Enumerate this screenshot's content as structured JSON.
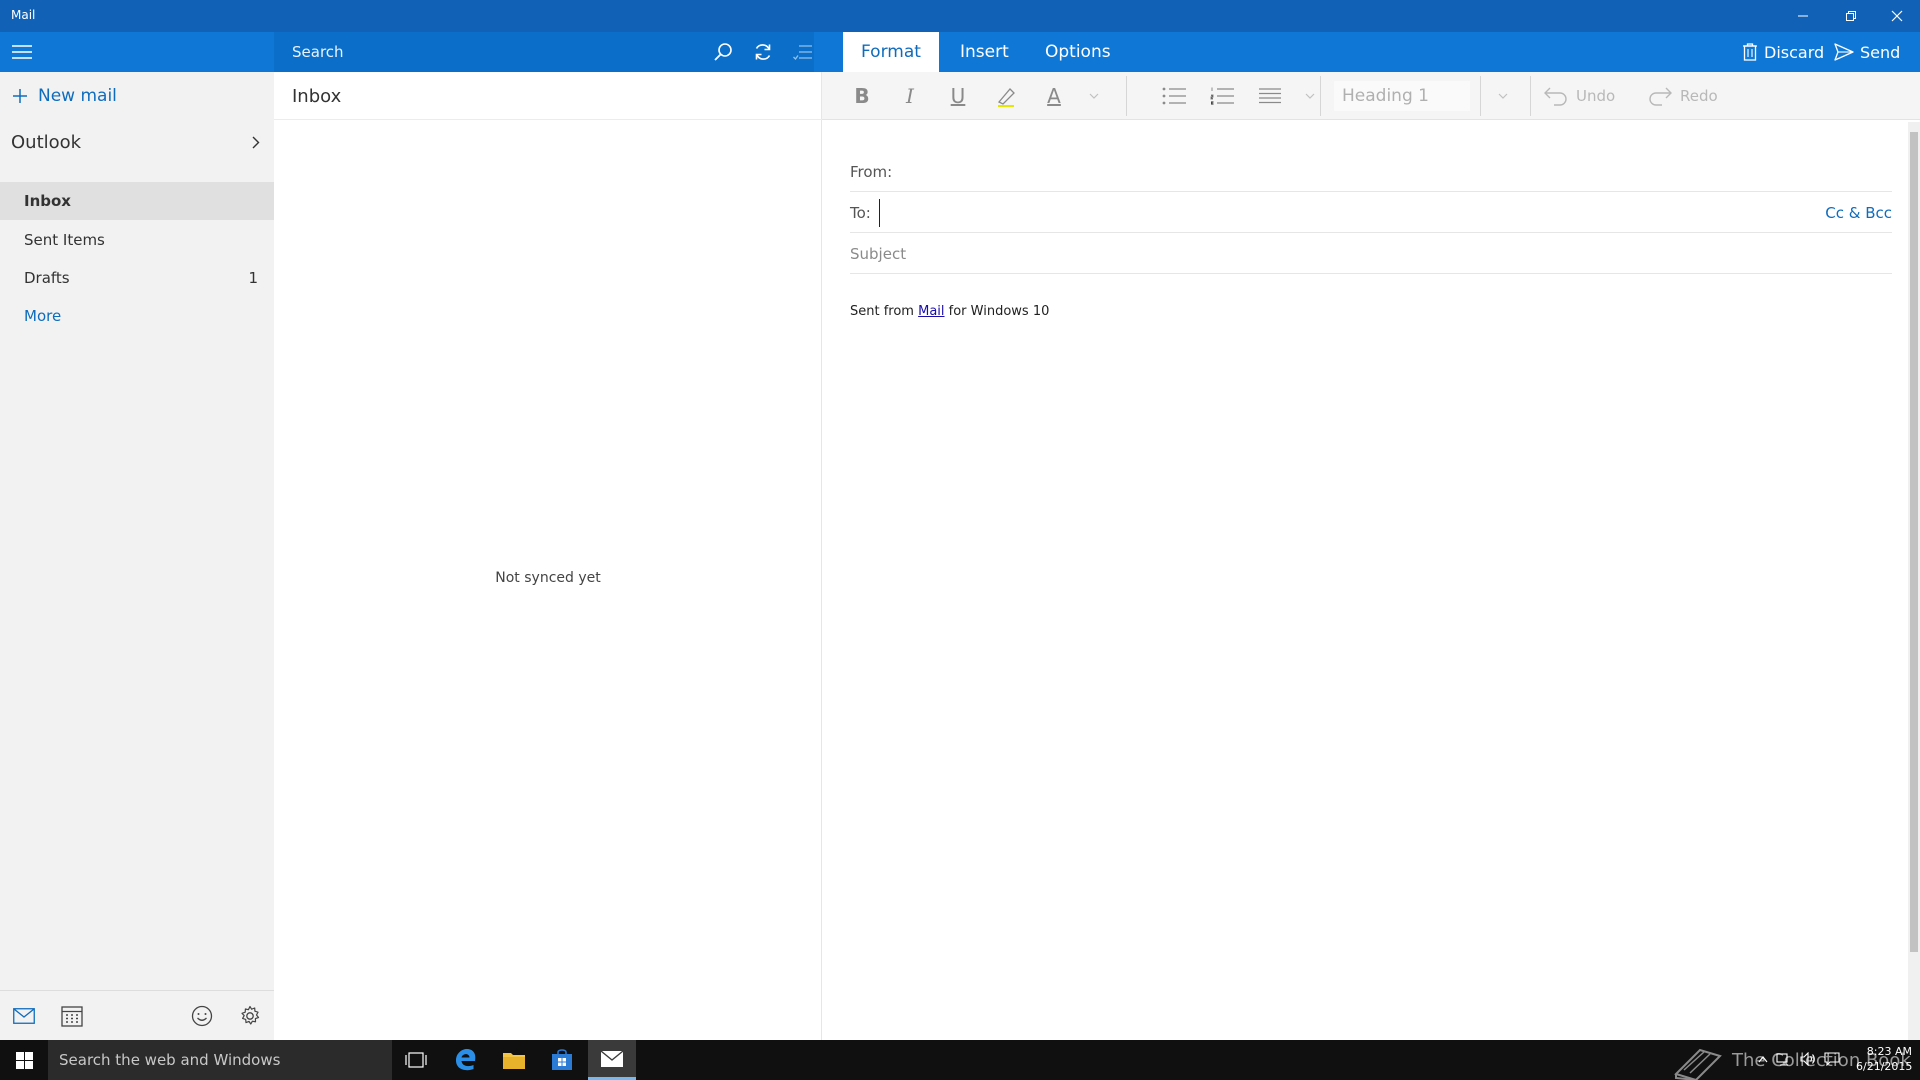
{
  "window": {
    "title": "Mail"
  },
  "commandbar": {
    "search_placeholder": "Search",
    "tabs": [
      {
        "label": "Format",
        "active": true
      },
      {
        "label": "Insert",
        "active": false
      },
      {
        "label": "Options",
        "active": false
      }
    ],
    "discard_label": "Discard",
    "send_label": "Send"
  },
  "nav": {
    "new_mail_label": "New mail",
    "account": "Outlook",
    "folders": [
      {
        "label": "Inbox",
        "count": "",
        "selected": true
      },
      {
        "label": "Sent Items",
        "count": "",
        "selected": false
      },
      {
        "label": "Drafts",
        "count": "1",
        "selected": false
      }
    ],
    "more_label": "More"
  },
  "message_list": {
    "title": "Inbox",
    "empty_text": "Not synced yet"
  },
  "compose": {
    "toolbar": {
      "bold": "B",
      "italic": "I",
      "underline": "U",
      "font_color": "A",
      "style": "Heading 1",
      "undo_label": "Undo",
      "redo_label": "Redo"
    },
    "from_label": "From:",
    "to_label": "To:",
    "to_value": "",
    "cc_bcc_label": "Cc & Bcc",
    "subject_placeholder": "Subject",
    "signature": {
      "before": "Sent from ",
      "link": "Mail",
      "after": " for Windows 10"
    }
  },
  "taskbar": {
    "search_placeholder": "Search the web and Windows",
    "watermark": "The Collection Book",
    "time": "8:23 AM",
    "date": "6/21/2015"
  },
  "colors": {
    "titlebar": "#1161b7",
    "commandbar": "#0f78d7",
    "accent": "#0f6cbd",
    "taskbar": "#101010"
  }
}
